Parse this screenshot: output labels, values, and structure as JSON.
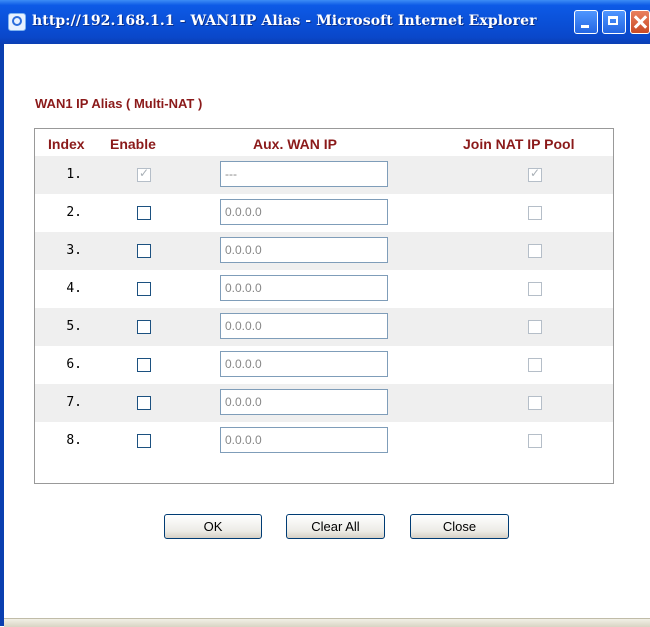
{
  "window": {
    "title": "http://192.168.1.1 - WAN1IP Alias - Microsoft Internet Explorer"
  },
  "section_title": "WAN1 IP Alias ( Multi-NAT )",
  "columns": {
    "index": "Index",
    "enable": "Enable",
    "aux_wan_ip": "Aux. WAN IP",
    "join_nat": "Join NAT IP Pool"
  },
  "rows": [
    {
      "index": "1.",
      "enable": true,
      "enable_disabled": true,
      "ip": "---",
      "join_nat": true
    },
    {
      "index": "2.",
      "enable": false,
      "enable_disabled": false,
      "ip": "0.0.0.0",
      "join_nat": false
    },
    {
      "index": "3.",
      "enable": false,
      "enable_disabled": false,
      "ip": "0.0.0.0",
      "join_nat": false
    },
    {
      "index": "4.",
      "enable": false,
      "enable_disabled": false,
      "ip": "0.0.0.0",
      "join_nat": false
    },
    {
      "index": "5.",
      "enable": false,
      "enable_disabled": false,
      "ip": "0.0.0.0",
      "join_nat": false
    },
    {
      "index": "6.",
      "enable": false,
      "enable_disabled": false,
      "ip": "0.0.0.0",
      "join_nat": false
    },
    {
      "index": "7.",
      "enable": false,
      "enable_disabled": false,
      "ip": "0.0.0.0",
      "join_nat": false
    },
    {
      "index": "8.",
      "enable": false,
      "enable_disabled": false,
      "ip": "0.0.0.0",
      "join_nat": false
    }
  ],
  "buttons": {
    "ok": "OK",
    "clear_all": "Clear All",
    "close": "Close"
  },
  "colors": {
    "heading": "#8b1a1a",
    "row_shade": "#efefef",
    "titlebar": "#0a4fd6"
  }
}
